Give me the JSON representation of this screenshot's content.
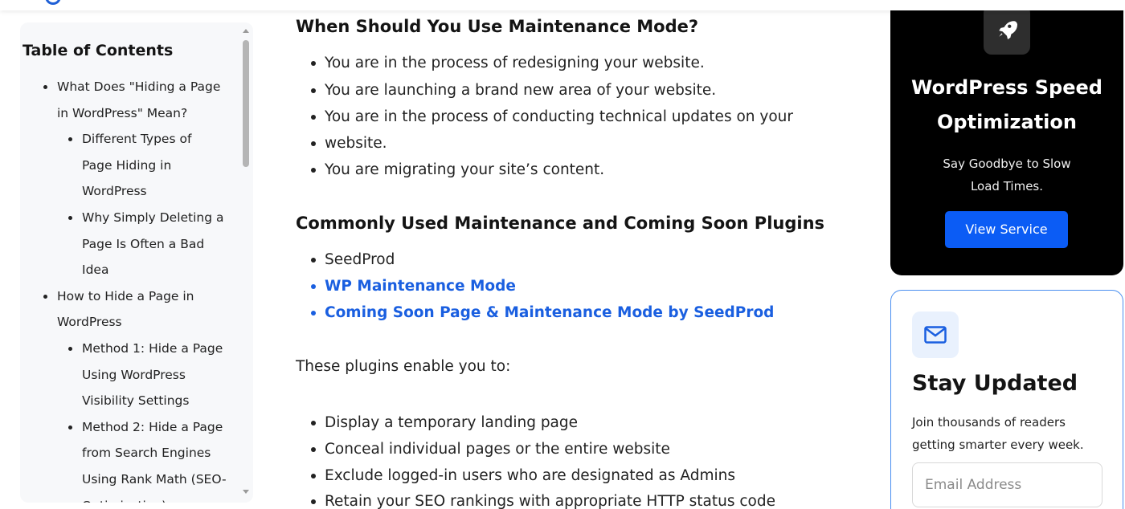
{
  "toc": {
    "title": "Table of Contents",
    "items": [
      {
        "lines": [
          "What Does \"Hiding a Page",
          "in WordPress\" Mean?"
        ],
        "level": 1
      },
      {
        "lines": [
          "Different Types of",
          "Page Hiding in",
          "WordPress"
        ],
        "level": 2
      },
      {
        "lines": [
          "Why Simply Deleting a",
          "Page Is Often a Bad",
          "Idea"
        ],
        "level": 2
      },
      {
        "lines": [
          "How to Hide a Page in",
          "WordPress"
        ],
        "level": 1
      },
      {
        "lines": [
          "Method 1: Hide a Page",
          "Using WordPress",
          "Visibility Settings"
        ],
        "level": 2
      },
      {
        "lines": [
          "Method 2: Hide a Page",
          "from Search Engines",
          "Using Rank Math (SEO-",
          "Optimization)"
        ],
        "level": 2
      }
    ]
  },
  "main": {
    "section1": {
      "heading": "When Should You Use Maintenance Mode?",
      "items": [
        "You are in the process of redesigning your website.",
        "You are launching a brand new area of your website.",
        "You are in the process of conducting technical updates on your",
        "website.",
        "You are migrating your site’s content."
      ]
    },
    "section2": {
      "heading": "Commonly Used Maintenance and Coming Soon Plugins",
      "items": [
        {
          "text": "SeedProd",
          "link": false
        },
        {
          "text": "WP Maintenance Mode",
          "link": true
        },
        {
          "text": "Coming Soon Page & Maintenance Mode by SeedProd",
          "link": true
        }
      ]
    },
    "intro": "These plugins enable you to:",
    "section3": {
      "items": [
        "Display a temporary landing page",
        "Conceal individual pages or the entire website",
        "Exclude logged-in users who are designated as Admins",
        "Retain your SEO rankings with appropriate HTTP status code"
      ]
    }
  },
  "promo": {
    "icon": "rocket-icon",
    "title_line1": "WordPress Speed",
    "title_line2": "Optimization",
    "subtitle_line1": "Say Goodbye to Slow",
    "subtitle_line2": "Load Times.",
    "button": "View Service",
    "accent": "#0b5cf5"
  },
  "newsletter": {
    "icon": "mail-icon",
    "title": "Stay Updated",
    "subtitle_line1": "Join thousands of readers",
    "subtitle_line2": "getting smarter every week.",
    "email_placeholder": "Email Address",
    "border_color": "#4a8ff0"
  }
}
